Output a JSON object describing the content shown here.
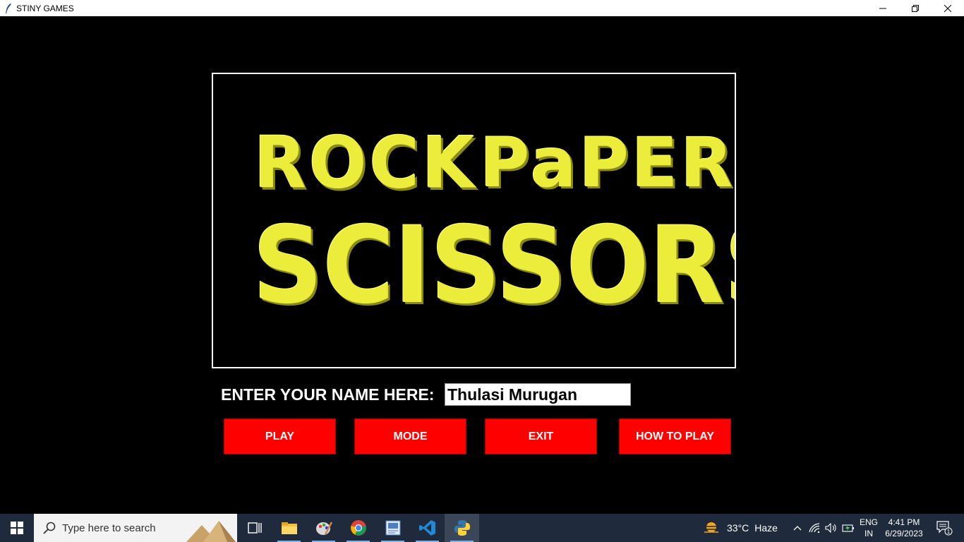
{
  "window": {
    "title": "STINY GAMES",
    "controls": [
      "minimize",
      "restore",
      "close"
    ]
  },
  "logo": {
    "line1_word1": "ROCK",
    "line1_word2": "PaPER",
    "line2": "SCISSORS",
    "color": "#ecec3a"
  },
  "form": {
    "name_label": "ENTER YOUR NAME HERE:",
    "name_value": "Thulasi Murugan"
  },
  "buttons": {
    "play": "PLAY",
    "mode": "MODE",
    "exit": "EXIT",
    "how_to_play": "HOW TO PLAY",
    "color": "#ff0000"
  },
  "taskbar": {
    "search_placeholder": "Type here to search",
    "apps": [
      "task-view-icon",
      "file-explorer-icon",
      "paint-icon",
      "chrome-icon",
      "photos-icon",
      "vscode-icon",
      "python-icon"
    ],
    "weather_temp": "33°C",
    "weather_desc": "Haze",
    "lang_line1": "ENG",
    "lang_line2": "IN",
    "time": "4:41 PM",
    "date": "6/29/2023",
    "notification_count": "1"
  }
}
